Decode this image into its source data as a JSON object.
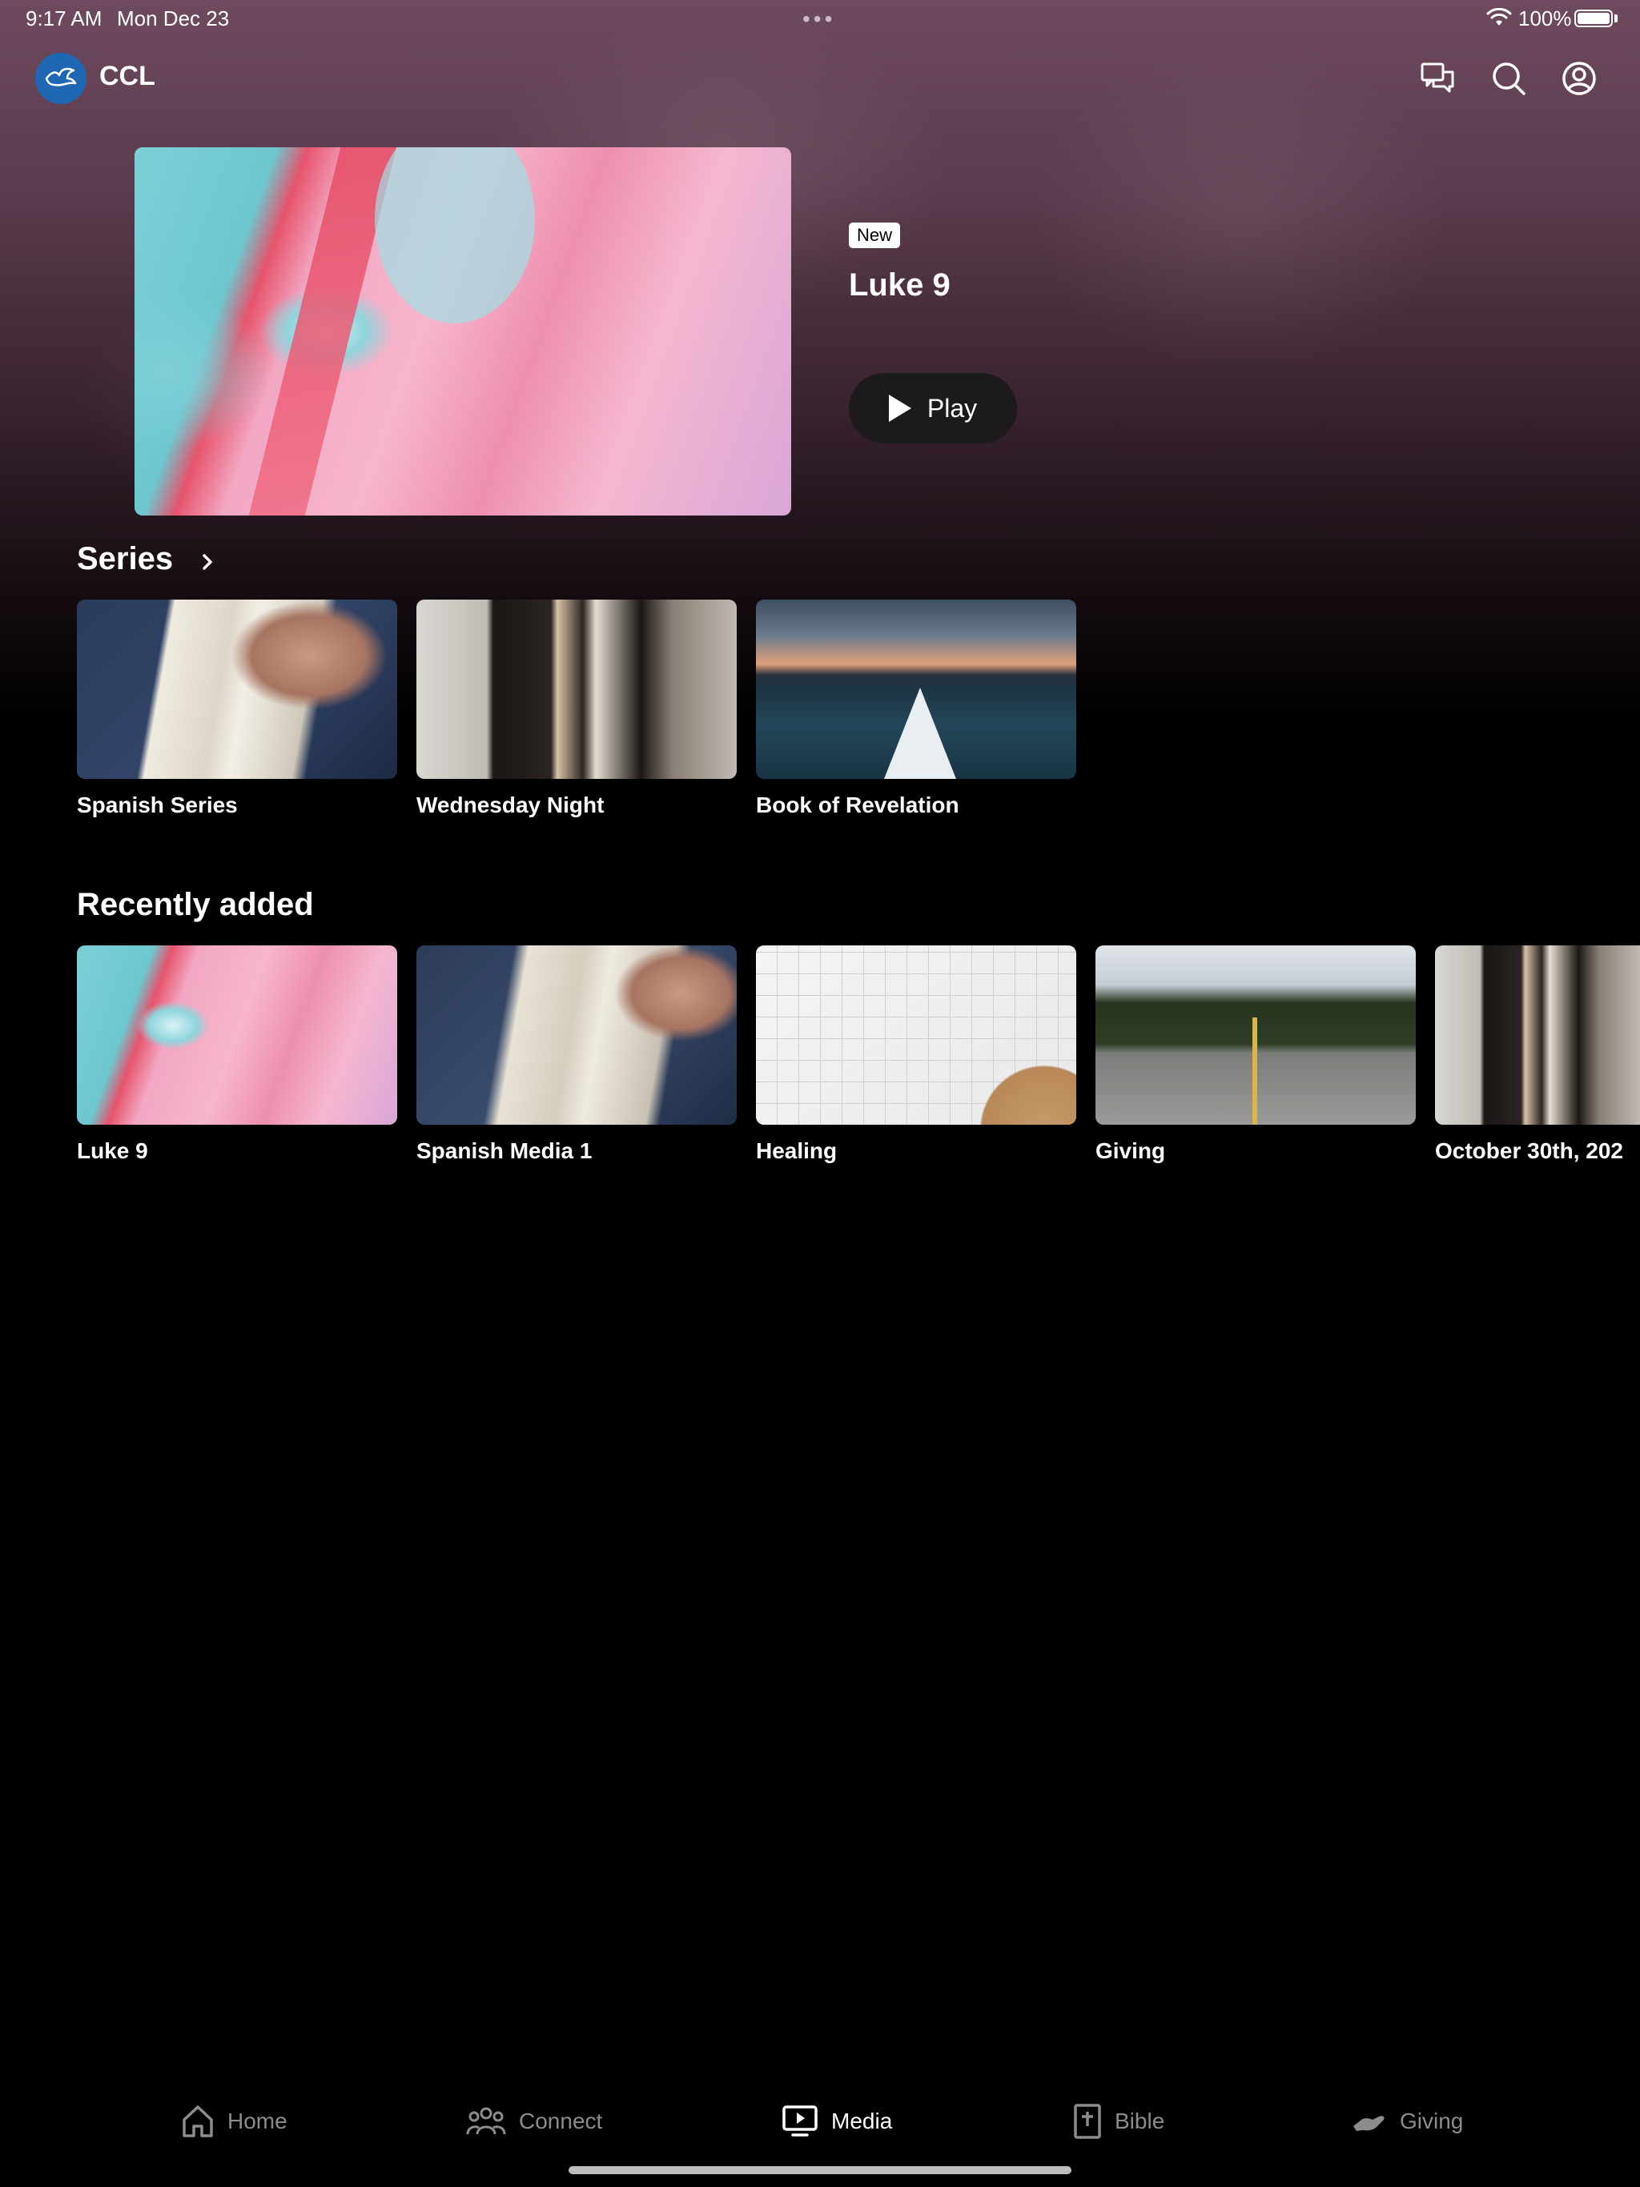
{
  "status_bar": {
    "time": "9:17 AM",
    "date": "Mon Dec 23",
    "multitask": "•••",
    "battery": "100%"
  },
  "header": {
    "app_name": "CCL",
    "icons": [
      "chat-icon",
      "search-icon",
      "profile-icon"
    ]
  },
  "featured": {
    "badge": "New",
    "title": "Luke 9",
    "play_label": "Play"
  },
  "series": {
    "heading": "Series",
    "items": [
      {
        "label": "Spanish Series"
      },
      {
        "label": "Wednesday Night"
      },
      {
        "label": "Book of Revelation"
      }
    ]
  },
  "recent": {
    "heading": "Recently added",
    "items": [
      {
        "label": "Luke 9"
      },
      {
        "label": "Spanish Media 1"
      },
      {
        "label": "Healing"
      },
      {
        "label": "Giving"
      },
      {
        "label": "October 30th, 202"
      }
    ]
  },
  "tabs": [
    {
      "label": "Home",
      "icon": "home-icon",
      "active": false
    },
    {
      "label": "Connect",
      "icon": "people-icon",
      "active": false
    },
    {
      "label": "Media",
      "icon": "tv-icon",
      "active": true
    },
    {
      "label": "Bible",
      "icon": "bible-icon",
      "active": false
    },
    {
      "label": "Giving",
      "icon": "giving-hand-icon",
      "active": false
    }
  ],
  "colors": {
    "background": "#000000",
    "logo_blue": "#1e67b3",
    "tab_inactive": "#8c8c8c",
    "tab_active": "#ffffff"
  }
}
